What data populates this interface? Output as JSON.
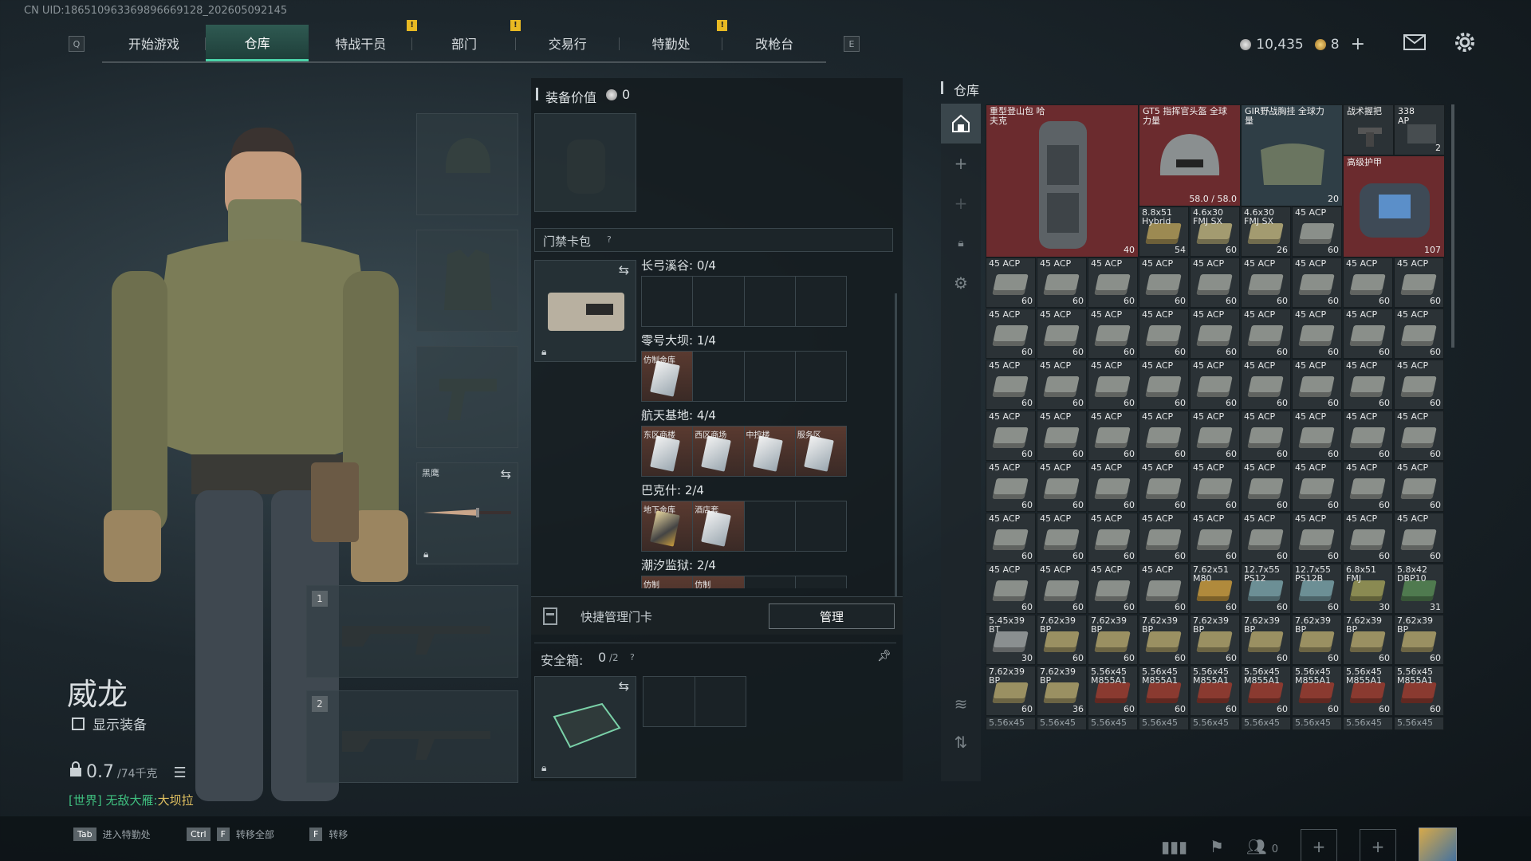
{
  "uid": "CN UID:186510963369896669128_202605092145",
  "nav": {
    "left_key": "Q",
    "right_key": "E",
    "tabs": [
      {
        "label": "开始游戏",
        "alert": false
      },
      {
        "label": "仓库",
        "alert": false,
        "active": true
      },
      {
        "label": "特战干员",
        "alert": true
      },
      {
        "label": "部门",
        "alert": true
      },
      {
        "label": "交易行",
        "alert": false
      },
      {
        "label": "特勤处",
        "alert": true
      },
      {
        "label": "改枪台",
        "alert": false
      }
    ],
    "alert_mark": "!"
  },
  "currency": {
    "silver": "10,435",
    "gold": "8",
    "add": "+"
  },
  "character": {
    "name": "威龙",
    "show_equipment": "显示装备",
    "weight": "0.7",
    "weight_max": "/74千克",
    "world_prefix": "[世界]",
    "world_team": "无敌大雁:",
    "world_msg": "大坝拉"
  },
  "slots": {
    "melee_label": "黑鹰",
    "primary_num": "1",
    "secondary_num": "2"
  },
  "mid": {
    "equip_value_label": "装备价值",
    "equip_value": "0",
    "keycard_pack_label": "门禁卡包",
    "help": "?",
    "maps": [
      {
        "name": "长弓溪谷: 0/4",
        "cards": [
          null,
          null,
          null,
          null
        ]
      },
      {
        "name": "零号大坝: 1/4",
        "cards": [
          "仿制金库",
          null,
          null,
          null
        ]
      },
      {
        "name": "航天基地: 4/4",
        "cards": [
          "东区商楼",
          "西区商场",
          "中控楼",
          "服务区"
        ]
      },
      {
        "name": "巴克什: 2/4",
        "cards": [
          "地下金库",
          "酒店套"
        ]
      },
      {
        "name": "潮汐监狱: 2/4",
        "cards": [
          "仿制",
          "仿制"
        ]
      }
    ],
    "quick_manage": "快捷管理门卡",
    "manage_btn": "管理",
    "safebox_label": "安全箱:",
    "safebox_value": "0",
    "safebox_max": "/2"
  },
  "storage": {
    "title": "仓库",
    "big_items": [
      {
        "name": "重型登山包 哈夫克",
        "count": "40"
      },
      {
        "name": "GT5 指挥官头盔 全球力量",
        "count": "58.0 / 58.0"
      },
      {
        "name": "GIR野战胸挂 全球力量",
        "count": "20"
      },
      {
        "name": "战术握把",
        "count": ""
      },
      {
        "name": "338 AP",
        "count": "2"
      },
      {
        "name": "高级护甲",
        "count": "107"
      }
    ],
    "row1_small": [
      {
        "label": "8.8x51 Hybrid",
        "count": "54"
      },
      {
        "label": "4.6x30 FMJ SX",
        "count": "60"
      },
      {
        "label": "4.6x30 FMJ SX",
        "count": "26"
      },
      {
        "label": "45 ACP",
        "count": "60"
      }
    ],
    "ammo_label": "45 ACP",
    "ammo_count": "60",
    "row9": [
      {
        "label": "45 ACP",
        "count": "60"
      },
      {
        "label": "45 ACP",
        "count": "60"
      },
      {
        "label": "45 ACP",
        "count": "60"
      },
      {
        "label": "45 ACP",
        "count": "60"
      },
      {
        "label": "7.62x51 M80",
        "count": "60"
      },
      {
        "label": "12.7x55 PS12",
        "count": "60"
      },
      {
        "label": "12.7x55 PS12B",
        "count": "60"
      },
      {
        "label": "6.8x51 FMJ",
        "count": "30"
      },
      {
        "label": "5.8x42 DBP10",
        "count": "31"
      }
    ],
    "row10": [
      {
        "label": "5.45x39 BT",
        "count": "30"
      },
      {
        "label": "7.62x39 BP",
        "count": "60"
      },
      {
        "label": "7.62x39 BP",
        "count": "60"
      },
      {
        "label": "7.62x39 BP",
        "count": "60"
      },
      {
        "label": "7.62x39 BP",
        "count": "60"
      },
      {
        "label": "7.62x39 BP",
        "count": "60"
      },
      {
        "label": "7.62x39 BP",
        "count": "60"
      },
      {
        "label": "7.62x39 BP",
        "count": "60"
      },
      {
        "label": "7.62x39 BP",
        "count": "60"
      }
    ],
    "row11": [
      {
        "label": "7.62x39 BP",
        "count": "60"
      },
      {
        "label": "7.62x39 BP",
        "count": "36"
      },
      {
        "label": "5.56x45 M855A1",
        "count": "60"
      },
      {
        "label": "5.56x45 M855A1",
        "count": "60"
      },
      {
        "label": "5.56x45 M855A1",
        "count": "60"
      },
      {
        "label": "5.56x45 M855A1",
        "count": "60"
      },
      {
        "label": "5.56x45 M855A1",
        "count": "60"
      },
      {
        "label": "5.56x45 M855A1",
        "count": "60"
      },
      {
        "label": "5.56x45 M855A1",
        "count": "60"
      }
    ],
    "row12_label": "5.56x45"
  },
  "bottom": {
    "hint1_key": "Tab",
    "hint1": "进入特勤处",
    "hint2_key1": "Ctrl",
    "hint2_key2": "F",
    "hint2": "转移全部",
    "hint3_key": "F",
    "hint3": "转移",
    "friends": "0"
  },
  "colors": {
    "accent": "#4bd3a8",
    "alert": "#e8b923",
    "red_bg": "#6b2b2e",
    "world_green": "#3fbf7f",
    "world_yellow": "#e0c060"
  }
}
